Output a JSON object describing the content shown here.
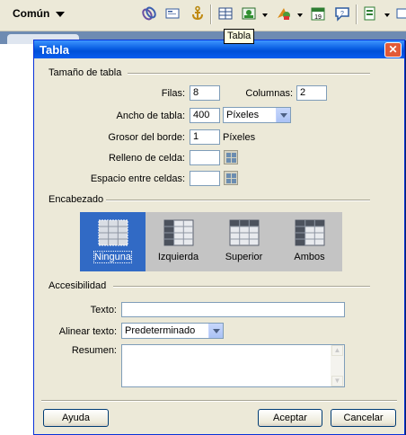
{
  "toolbar": {
    "category": "Común",
    "icons": [
      "hyperlink-icon",
      "email-link-icon",
      "named-anchor-icon",
      "table-icon",
      "image-icon",
      "media-icon",
      "date-icon",
      "comment-icon",
      "template-icon",
      "tag-chooser-icon"
    ],
    "tooltip": "Tabla"
  },
  "dialog": {
    "title": "Tabla",
    "close_glyph": "✕",
    "table_size": {
      "section": "Tamaño de tabla",
      "rows_label": "Filas:",
      "rows_value": "8",
      "cols_label": "Columnas:",
      "cols_value": "2",
      "width_label": "Ancho de tabla:",
      "width_value": "400",
      "width_unit": "Píxeles",
      "border_label": "Grosor del borde:",
      "border_value": "1",
      "border_unit": "Píxeles",
      "padding_label": "Relleno de celda:",
      "padding_value": "",
      "spacing_label": "Espacio entre celdas:",
      "spacing_value": ""
    },
    "header": {
      "section": "Encabezado",
      "options": [
        "Ninguna",
        "Izquierda",
        "Superior",
        "Ambos"
      ],
      "selected": "Ninguna"
    },
    "accessibility": {
      "section": "Accesibilidad",
      "caption_label": "Texto:",
      "caption_value": "",
      "align_label": "Alinear texto:",
      "align_value": "Predeterminado",
      "summary_label": "Resumen:",
      "summary_value": ""
    },
    "buttons": {
      "help": "Ayuda",
      "ok": "Aceptar",
      "cancel": "Cancelar"
    }
  }
}
